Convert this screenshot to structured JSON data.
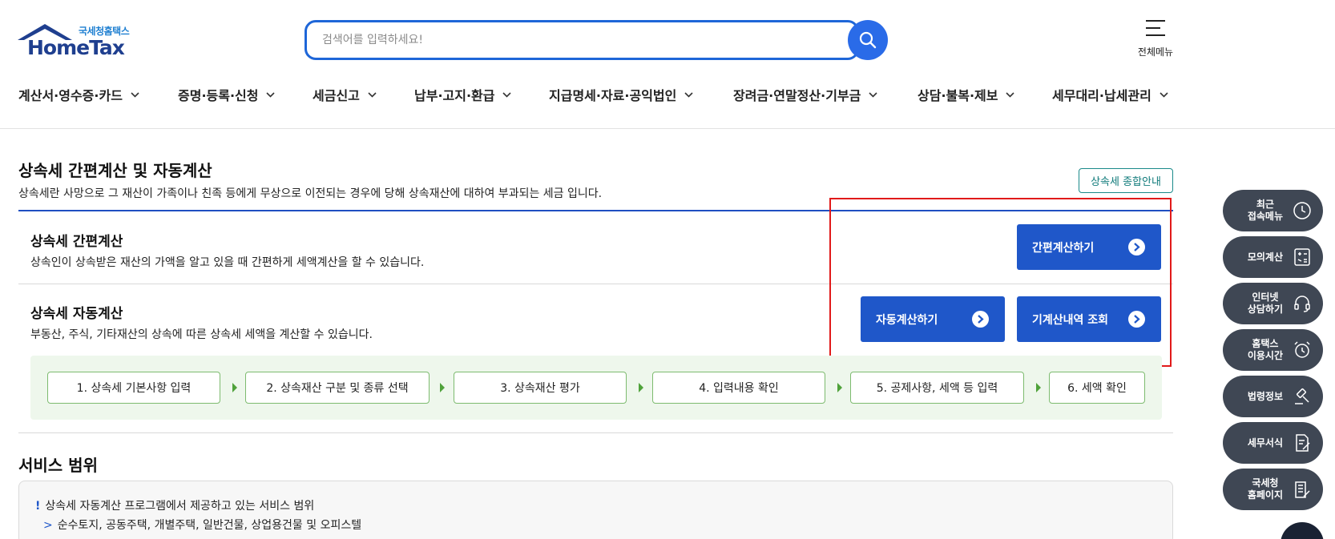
{
  "header": {
    "logo_sub": "국세청홈택스",
    "logo_main": "HomeTax",
    "search_placeholder": "검색어를 입력하세요!",
    "all_menu_label": "전체메뉴"
  },
  "gnb": [
    {
      "label": "계산서·영수증·카드"
    },
    {
      "label": "증명·등록·신청"
    },
    {
      "label": "세금신고"
    },
    {
      "label": "납부·고지·환급"
    },
    {
      "label": "지급명세·자료·공익법인"
    },
    {
      "label": "장려금·연말정산·기부금"
    },
    {
      "label": "상담·불복·제보"
    },
    {
      "label": "세무대리·납세관리"
    }
  ],
  "page": {
    "title": "상속세 간편계산 및 자동계산",
    "description": "상속세란 사망으로 그 재산이 가족이나 친족 등에게 무상으로 이전되는 경우에 당해 상속재산에 대하여 부과되는 세금 입니다.",
    "guide_button": "상속세 종합안내"
  },
  "simple_calc": {
    "title": "상속세 간편계산",
    "description": "상속인이 상속받은 재산의 가액을 알고 있을 때 간편하게 세액계산을 할 수 있습니다.",
    "button": "간편계산하기"
  },
  "auto_calc": {
    "title": "상속세 자동계산",
    "description": "부동산, 주식, 기타재산의 상속에 따른 상속세 세액을 계산할 수 있습니다.",
    "button": "자동계산하기",
    "history_button": "기계산내역 조회"
  },
  "steps": [
    {
      "label": "1. 상속세 기본사항 입력"
    },
    {
      "label": "2. 상속재산 구분 및 종류 선택"
    },
    {
      "label": "3. 상속재산 평가"
    },
    {
      "label": "4. 입력내용 확인"
    },
    {
      "label": "5. 공제사항, 세액 등 입력"
    },
    {
      "label": "6. 세액 확인"
    }
  ],
  "scope": {
    "title": "서비스 범위",
    "note": "상속세 자동계산 프로그램에서 제공하고 있는 서비스 범위",
    "item": "순수토지, 공동주택, 개별주택, 일반건물, 상업용건물 및 오피스텔"
  },
  "quick_menu": [
    {
      "label": "최근\n접속메뉴",
      "icon": "clock-icon"
    },
    {
      "label": "모의계산",
      "icon": "calculator-icon"
    },
    {
      "label": "인터넷\n상담하기",
      "icon": "headset-icon"
    },
    {
      "label": "홈택스\n이용시간",
      "icon": "alarm-icon"
    },
    {
      "label": "법령정보",
      "icon": "gavel-icon"
    },
    {
      "label": "세무서식",
      "icon": "document-edit-icon"
    },
    {
      "label": "국세청\n홈페이지",
      "icon": "building-icon"
    }
  ],
  "colors": {
    "primary": "#1f57c9",
    "search_border": "#1e66d8",
    "highlight": "#e11a1a",
    "quick_bg": "#3f4754",
    "step_bg": "#eef7ec"
  }
}
